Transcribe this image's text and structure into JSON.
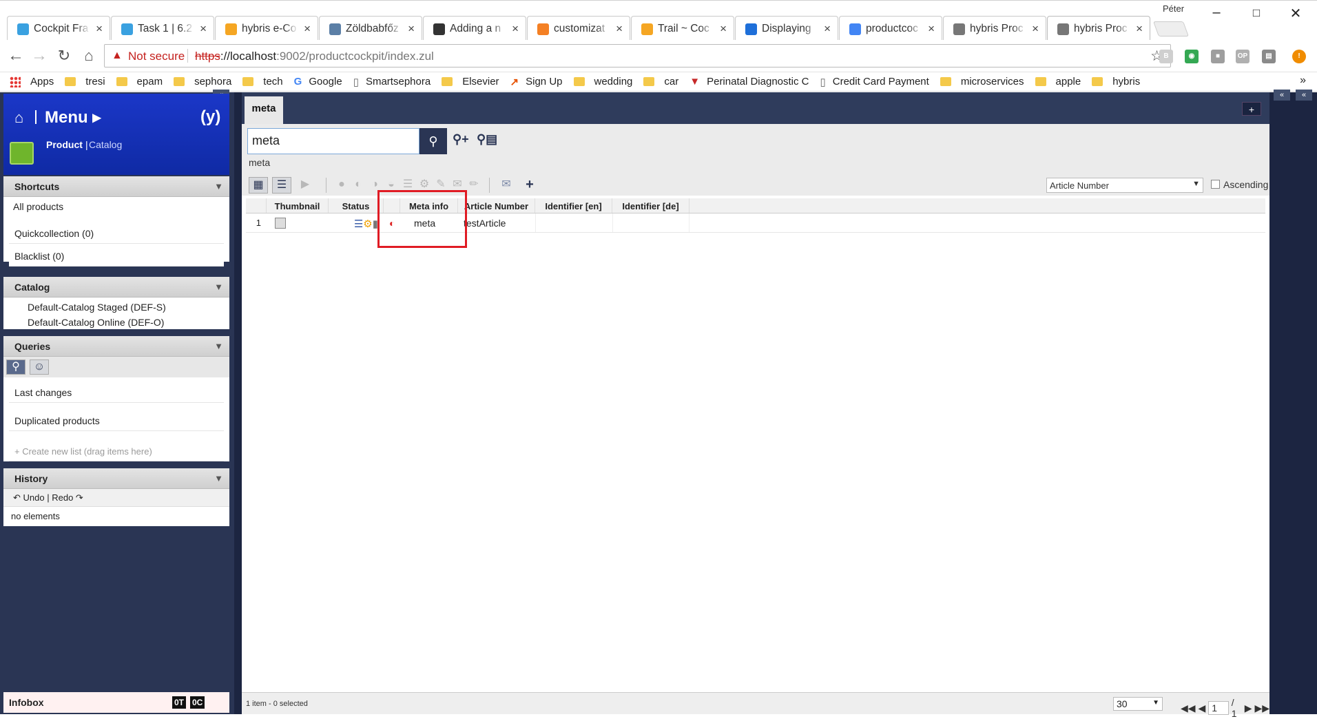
{
  "browser": {
    "user": "Péter",
    "tabs": [
      {
        "title": "Cockpit Fra",
        "favicon_color": "#3aa1e0"
      },
      {
        "title": "Task 1 | 6.2",
        "favicon_color": "#3aa1e0"
      },
      {
        "title": "hybris e-Co",
        "favicon_color": "#f5a623"
      },
      {
        "title": "Zöldbabfőz",
        "favicon_color": "#5b7fa6"
      },
      {
        "title": "Adding a n",
        "favicon_color": "#333333"
      },
      {
        "title": "customizat",
        "favicon_color": "#f48024"
      },
      {
        "title": "Trail ~ Coc",
        "favicon_color": "#f5a623"
      },
      {
        "title": "Displaying",
        "favicon_color": "#1e6fd9"
      },
      {
        "title": "productcoc",
        "favicon_color": "#4285f4"
      },
      {
        "title": "hybris Proc",
        "favicon_color": "#777777"
      },
      {
        "title": "hybris Proc",
        "favicon_color": "#777777"
      }
    ],
    "address": {
      "not_secure": "Not secure",
      "scheme": "https",
      "host": "://localhost",
      "path": ":9002/productcockpit/index.zul"
    },
    "bookmarks": [
      {
        "label": "Apps",
        "icon": "apps-icon"
      },
      {
        "label": "tresi",
        "icon": "folder-icon"
      },
      {
        "label": "epam",
        "icon": "folder-icon"
      },
      {
        "label": "sephora",
        "icon": "folder-icon"
      },
      {
        "label": "tech",
        "icon": "folder-icon"
      },
      {
        "label": "Google",
        "icon": "google-icon"
      },
      {
        "label": "Smartsephora",
        "icon": "page-icon"
      },
      {
        "label": "Elsevier",
        "icon": "folder-icon"
      },
      {
        "label": "Sign Up",
        "icon": "signup-icon"
      },
      {
        "label": "wedding",
        "icon": "folder-icon"
      },
      {
        "label": "car",
        "icon": "folder-icon"
      },
      {
        "label": "Perinatal Diagnostic C",
        "icon": "shield-icon"
      },
      {
        "label": "Credit Card Payment",
        "icon": "page-icon"
      },
      {
        "label": "microservices",
        "icon": "folder-icon"
      },
      {
        "label": "apple",
        "icon": "folder-icon"
      },
      {
        "label": "hybris",
        "icon": "folder-icon"
      }
    ]
  },
  "sidebar": {
    "menu_title": "Menu",
    "perspective_active": "Product",
    "perspective_other": "Catalog",
    "shortcuts": {
      "title": "Shortcuts",
      "all": "All products",
      "items": [
        "Quickcollection (0)",
        "Blacklist (0)"
      ]
    },
    "catalog": {
      "title": "Catalog",
      "items": [
        "Default-Catalog Staged (DEF-S)",
        "Default-Catalog Online (DEF-O)"
      ]
    },
    "queries": {
      "title": "Queries",
      "items": [
        "Last changes",
        "Duplicated products"
      ],
      "new_list": "+ Create new list (drag items here)"
    },
    "history": {
      "title": "History",
      "undo": "Undo",
      "redo": "Redo",
      "empty": "no elements"
    },
    "infobox": {
      "title": "Infobox",
      "count_t": "0T",
      "count_c": "0C"
    }
  },
  "main": {
    "tab_label": "meta",
    "search_value": "meta",
    "search_echo": "meta",
    "sort_field": "Article Number",
    "ascending_label": "Ascending",
    "columns": [
      "Thumbnail",
      "Status",
      "Meta info",
      "Article Number",
      "Identifier [en]",
      "Identifier [de]"
    ],
    "row": {
      "index": "1",
      "meta_info": "meta",
      "article_number": "testArticle",
      "identifier_en": "",
      "identifier_de": ""
    },
    "status_text": "1 item - 0 selected",
    "page_size": "30",
    "page_current": "1",
    "page_total": "/ 1"
  }
}
